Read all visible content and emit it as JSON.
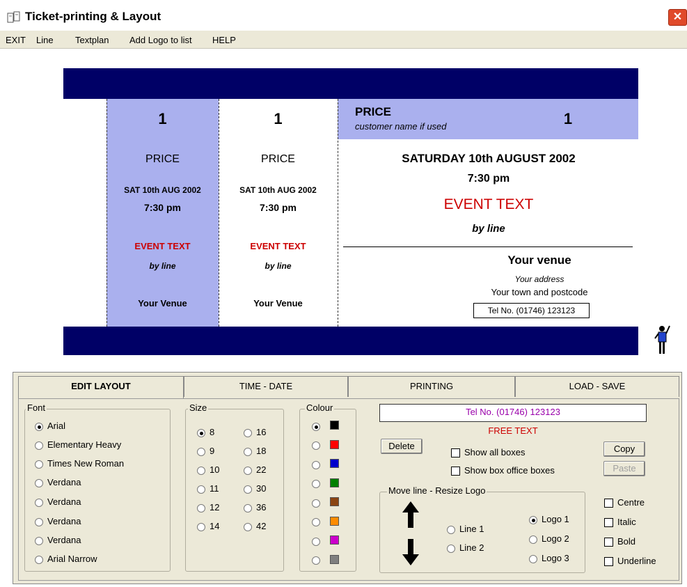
{
  "window": {
    "title": "Ticket-printing & Layout",
    "close_glyph": "✕"
  },
  "menu": {
    "items": [
      "EXIT",
      "Line",
      "Textplan",
      "Add Logo to list",
      "HELP"
    ]
  },
  "ticket": {
    "stub1": {
      "number": "1",
      "price": "PRICE",
      "date": "SAT 10th AUG 2002",
      "time": "7:30 pm",
      "event": "EVENT TEXT",
      "by_line": "by line",
      "venue": "Your Venue"
    },
    "stub2": {
      "number": "1",
      "price": "PRICE",
      "date": "SAT 10th AUG 2002",
      "time": "7:30 pm",
      "event": "EVENT TEXT",
      "by_line": "by line",
      "venue": "Your Venue"
    },
    "main": {
      "price": "PRICE",
      "customer": "customer name if used",
      "number": "1",
      "date": "SATURDAY 10th AUGUST 2002",
      "time": "7:30 pm",
      "event": "EVENT TEXT",
      "by_line": "by line",
      "venue": "Your venue",
      "address": "Your address",
      "town": "Your town and postcode",
      "tel": "Tel No. (01746) 123123"
    }
  },
  "tabs": [
    "EDIT LAYOUT",
    "TIME - DATE",
    "PRINTING",
    "LOAD - SAVE"
  ],
  "font_group": {
    "title": "Font",
    "options": [
      "Arial",
      "Elementary Heavy",
      "Times New Roman",
      "Verdana",
      "Verdana",
      "Verdana",
      "Verdana",
      "Arial Narrow"
    ],
    "selected": 0
  },
  "size_group": {
    "title": "Size",
    "col1": [
      "8",
      "9",
      "10",
      "11",
      "12",
      "14"
    ],
    "col2": [
      "16",
      "18",
      "22",
      "30",
      "36",
      "42"
    ],
    "selected": "8"
  },
  "colour_group": {
    "title": "Colour",
    "colors": [
      "#000000",
      "#ff0000",
      "#0000cc",
      "#008000",
      "#8b4513",
      "#ff8c00",
      "#cc00cc",
      "#808080"
    ],
    "selected": 0
  },
  "editor": {
    "text_value": "Tel No. (01746) 123123",
    "free_text": "FREE TEXT",
    "text_color": "#9900aa",
    "free_text_color": "#cc0000"
  },
  "buttons": {
    "delete": "Delete",
    "copy": "Copy",
    "paste": "Paste"
  },
  "checks": {
    "show_all_boxes": "Show all boxes",
    "show_box_office": "Show box office boxes"
  },
  "move_group": {
    "title": "Move line - Resize Logo",
    "line1": "Line 1",
    "line2": "Line 2",
    "logo1": "Logo 1",
    "logo2": "Logo 2",
    "logo3": "Logo 3",
    "selected": "Logo 1"
  },
  "style_checks": [
    "Centre",
    "Italic",
    "Bold",
    "Underline"
  ],
  "palette": {
    "band": "#000066",
    "stub": "#aab0ee",
    "panel": "#ece9d8"
  }
}
